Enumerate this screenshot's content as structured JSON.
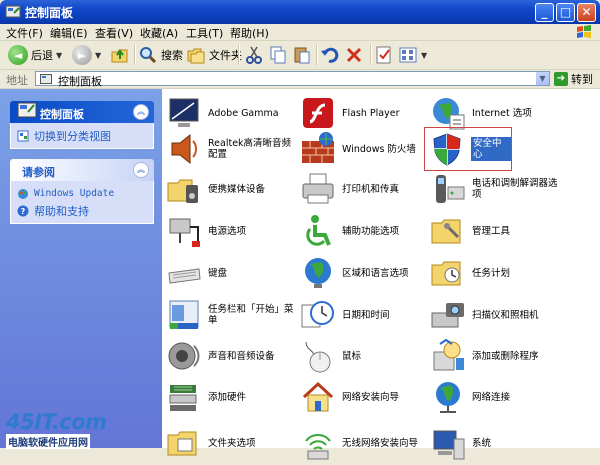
{
  "window": {
    "title": "控制面板"
  },
  "menu": [
    "文件(F)",
    "编辑(E)",
    "查看(V)",
    "收藏(A)",
    "工具(T)",
    "帮助(H)"
  ],
  "toolbar": {
    "back": "后退",
    "search": "搜索",
    "folders": "文件夹"
  },
  "address": {
    "label": "地址",
    "value": "控制面板",
    "go": "转到"
  },
  "sidebar": {
    "panel1": {
      "title": "控制面板",
      "links": [
        "切换到分类视图"
      ]
    },
    "panel2": {
      "title": "请参阅",
      "links": [
        "Windows Update",
        "帮助和支持"
      ]
    }
  },
  "watermark": {
    "main": "45IT.com",
    "sub": "电脑软硬件应用网"
  },
  "items": [
    {
      "label": "Adobe Gamma",
      "icon": "monitor-icon"
    },
    {
      "label": "Flash Player",
      "icon": "flash-icon"
    },
    {
      "label": "Internet 选项",
      "icon": "globe-icon"
    },
    {
      "label": "Realtek高清晰音频配置",
      "icon": "speaker-icon"
    },
    {
      "label": "Windows 防火墙",
      "icon": "firewall-icon"
    },
    {
      "label": "安全中心",
      "icon": "shield-icon"
    },
    {
      "label": "便携媒体设备",
      "icon": "media-device-icon"
    },
    {
      "label": "打印机和传真",
      "icon": "printer-icon"
    },
    {
      "label": "电话和调制解调器选项",
      "icon": "phone-icon"
    },
    {
      "label": "电源选项",
      "icon": "power-icon"
    },
    {
      "label": "辅助功能选项",
      "icon": "accessibility-icon"
    },
    {
      "label": "管理工具",
      "icon": "admin-tools-icon"
    },
    {
      "label": "键盘",
      "icon": "keyboard-icon"
    },
    {
      "label": "区域和语言选项",
      "icon": "region-globe-icon"
    },
    {
      "label": "任务计划",
      "icon": "task-folder-icon"
    },
    {
      "label": "任务栏和「开始」菜单",
      "icon": "taskbar-icon"
    },
    {
      "label": "日期和时间",
      "icon": "clock-icon"
    },
    {
      "label": "扫描仪和照相机",
      "icon": "camera-icon"
    },
    {
      "label": "声音和音频设备",
      "icon": "audio-icon"
    },
    {
      "label": "鼠标",
      "icon": "mouse-icon"
    },
    {
      "label": "添加或删除程序",
      "icon": "add-remove-icon"
    },
    {
      "label": "添加硬件",
      "icon": "hardware-icon"
    },
    {
      "label": "网络安装向导",
      "icon": "home-network-icon"
    },
    {
      "label": "网络连接",
      "icon": "network-icon"
    },
    {
      "label": "文件夹选项",
      "icon": "folder-options-icon"
    },
    {
      "label": "无线网络安装向导",
      "icon": "wireless-icon"
    },
    {
      "label": "系统",
      "icon": "system-icon"
    }
  ],
  "colors": {
    "title_blue": "#0A35A6",
    "sidebar_blue": "#6375D6",
    "link_blue": "#215DC6",
    "selection": "#316AC5"
  }
}
